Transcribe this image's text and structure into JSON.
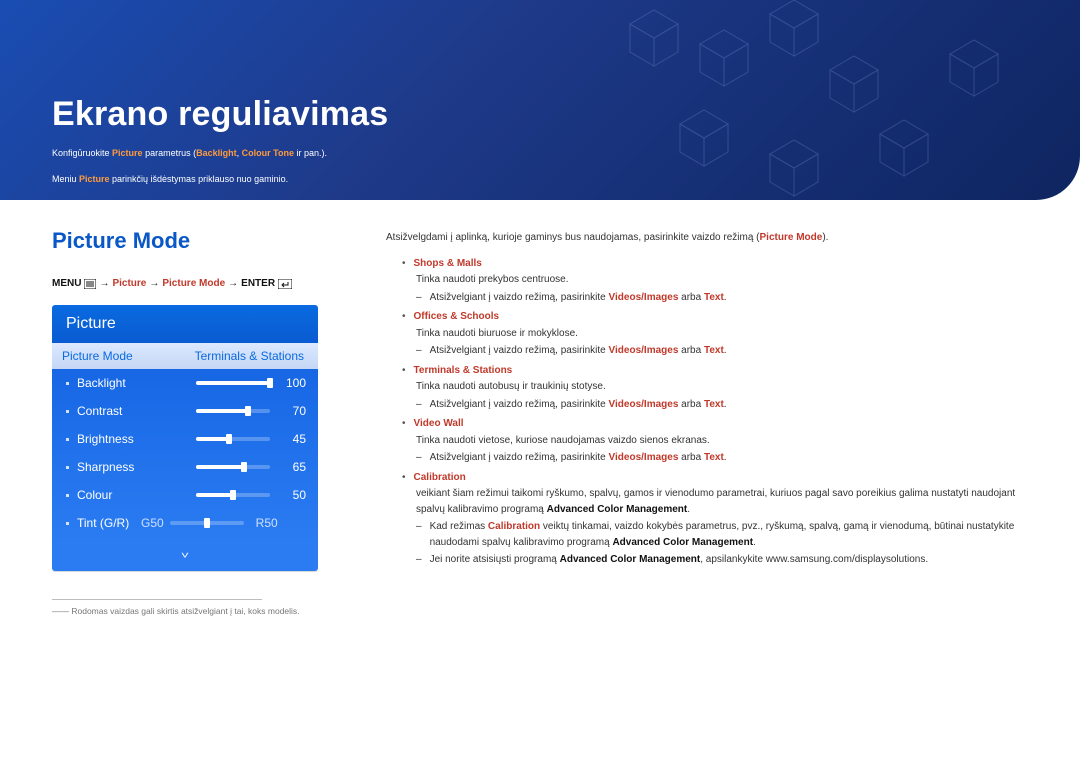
{
  "banner": {
    "title": "Ekrano reguliavimas",
    "line1_pre": "Konfigūruokite ",
    "line1_hl1": "Picture",
    "line1_mid": " parametrus (",
    "line1_hl2": "Backlight",
    "line1_sep": ", ",
    "line1_hl3": "Colour Tone",
    "line1_post": " ir pan.).",
    "line2_pre": "Meniu ",
    "line2_hl": "Picture",
    "line2_post": " parinkčių išdėstymas priklauso nuo gaminio."
  },
  "left": {
    "title": "Picture Mode",
    "crumb": {
      "menu": "MENU",
      "arrow": "→",
      "p1": "Picture",
      "p2": "Picture Mode",
      "enter": "ENTER"
    },
    "osd": {
      "header": "Picture",
      "mode_label": "Picture Mode",
      "mode_value": "Terminals & Stations",
      "rows": [
        {
          "label": "Backlight",
          "value": 100
        },
        {
          "label": "Contrast",
          "value": 70
        },
        {
          "label": "Brightness",
          "value": 45
        },
        {
          "label": "Sharpness",
          "value": 65
        },
        {
          "label": "Colour",
          "value": 50
        }
      ],
      "tint": {
        "label": "Tint (G/R)",
        "g": "G50",
        "r": "R50",
        "pos": 50
      }
    },
    "footnote": "――   Rodomas vaizdas gali skirtis atsižvelgiant į tai, koks modelis."
  },
  "right": {
    "intro_pre": "Atsižvelgdami į aplinką, kurioje gaminys bus naudojamas, pasirinkite vaizdo režimą (",
    "intro_hl": "Picture Mode",
    "intro_post": ").",
    "items": [
      {
        "name": "Shops & Malls",
        "desc": "Tinka naudoti prekybos centruose.",
        "sub": [
          {
            "pre": "Atsižvelgiant į vaizdo režimą, pasirinkite ",
            "hl1": "Videos/Images",
            "mid": " arba ",
            "hl2": "Text",
            "post": "."
          }
        ]
      },
      {
        "name": "Offices & Schools",
        "desc": "Tinka naudoti biuruose ir mokyklose.",
        "sub": [
          {
            "pre": "Atsižvelgiant į vaizdo režimą, pasirinkite ",
            "hl1": "Videos/Images",
            "mid": " arba ",
            "hl2": "Text",
            "post": "."
          }
        ]
      },
      {
        "name": "Terminals & Stations",
        "desc": "Tinka naudoti autobusų ir traukinių stotyse.",
        "sub": [
          {
            "pre": "Atsižvelgiant į vaizdo režimą, pasirinkite ",
            "hl1": "Videos/Images",
            "mid": " arba ",
            "hl2": "Text",
            "post": "."
          }
        ]
      },
      {
        "name": "Video Wall",
        "desc": "Tinka naudoti vietose, kuriose naudojamas vaizdo sienos ekranas.",
        "sub": [
          {
            "pre": "Atsižvelgiant į vaizdo režimą, pasirinkite ",
            "hl1": "Videos/Images",
            "mid": " arba ",
            "hl2": "Text",
            "post": "."
          }
        ]
      },
      {
        "name": "Calibration",
        "desc_pre": "veikiant šiam režimui taikomi ryškumo, spalvų, gamos ir vienodumo parametrai, kuriuos pagal savo poreikius galima nustatyti naudojant spalvų kalibravimo programą ",
        "desc_strong": "Advanced Color Management",
        "desc_post": ".",
        "sub": [
          {
            "pre": "Kad režimas ",
            "hl1": "Calibration",
            "mid": " veiktų tinkamai, vaizdo kokybės parametrus, pvz., ryškumą, spalvą, gamą ir vienodumą, būtinai nustatykite naudodami spalvų kalibravimo programą ",
            "strong": "Advanced Color Management",
            "post": "."
          },
          {
            "pre": "Jei norite atsisiųsti programą ",
            "strong": "Advanced Color Management",
            "post": ", apsilankykite www.samsung.com/displaysolutions."
          }
        ]
      }
    ]
  }
}
